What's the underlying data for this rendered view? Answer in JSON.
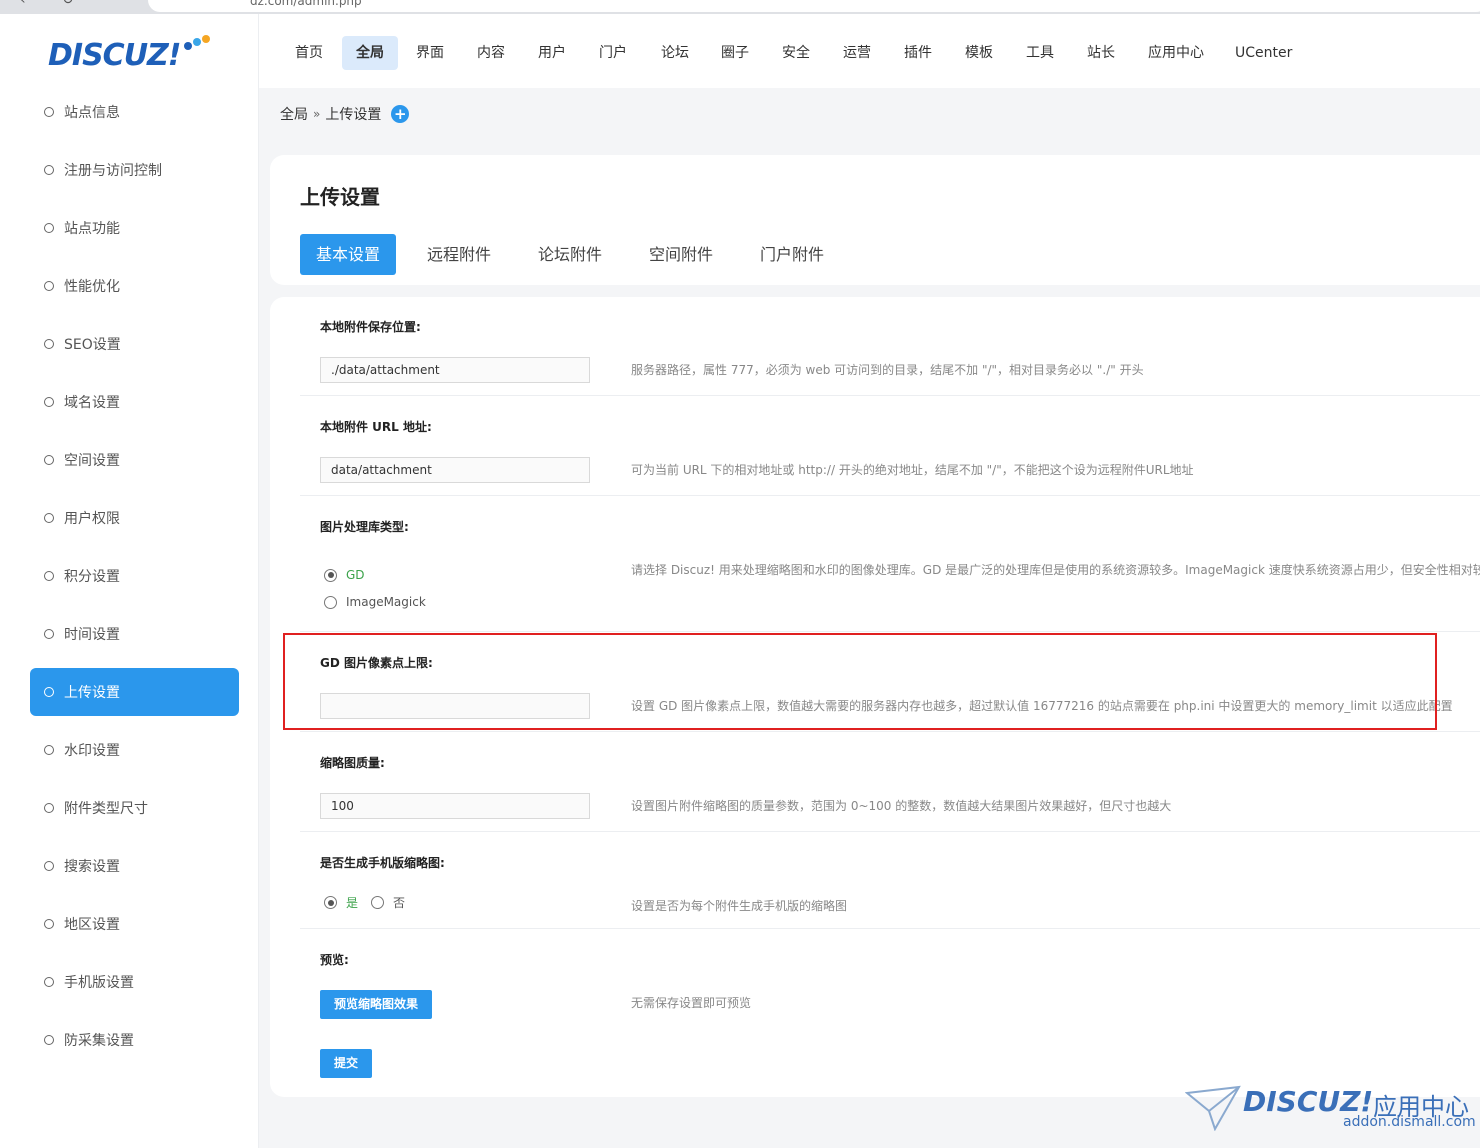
{
  "browser": {
    "url": "dz.com/admin.php"
  },
  "logo": {
    "text": "DISCUZ!"
  },
  "sidebar": {
    "items": [
      {
        "label": "站点信息"
      },
      {
        "label": "注册与访问控制"
      },
      {
        "label": "站点功能"
      },
      {
        "label": "性能优化"
      },
      {
        "label": "SEO设置"
      },
      {
        "label": "域名设置"
      },
      {
        "label": "空间设置"
      },
      {
        "label": "用户权限"
      },
      {
        "label": "积分设置"
      },
      {
        "label": "时间设置"
      },
      {
        "label": "上传设置",
        "active": true
      },
      {
        "label": "水印设置"
      },
      {
        "label": "附件类型尺寸"
      },
      {
        "label": "搜索设置"
      },
      {
        "label": "地区设置"
      },
      {
        "label": "手机版设置"
      },
      {
        "label": "防采集设置"
      }
    ]
  },
  "topnav": {
    "tabs": [
      {
        "label": "首页"
      },
      {
        "label": "全局",
        "active": true
      },
      {
        "label": "界面"
      },
      {
        "label": "内容"
      },
      {
        "label": "用户"
      },
      {
        "label": "门户"
      },
      {
        "label": "论坛"
      },
      {
        "label": "圈子"
      },
      {
        "label": "安全"
      },
      {
        "label": "运营"
      },
      {
        "label": "插件"
      },
      {
        "label": "模板"
      },
      {
        "label": "工具"
      },
      {
        "label": "站长"
      },
      {
        "label": "应用中心"
      },
      {
        "label": "UCenter"
      }
    ]
  },
  "breadcrumb": {
    "root": "全局",
    "sep": "»",
    "current": "上传设置",
    "plus": "+"
  },
  "header": {
    "title": "上传设置"
  },
  "subtabs": [
    {
      "label": "基本设置",
      "active": true
    },
    {
      "label": "远程附件"
    },
    {
      "label": "论坛附件"
    },
    {
      "label": "空间附件"
    },
    {
      "label": "门户附件"
    }
  ],
  "form": {
    "attach_dir": {
      "label": "本地附件保存位置:",
      "value": "./data/attachment",
      "hint": "服务器路径，属性 777，必须为 web 可访问到的目录，结尾不加 \"/\"，相对目录务必以 \"./\" 开头"
    },
    "attach_url": {
      "label": "本地附件 URL 地址:",
      "value": "data/attachment",
      "hint": "可为当前 URL 下的相对地址或 http:// 开头的绝对地址，结尾不加 \"/\"，不能把这个设为远程附件URL地址"
    },
    "image_lib": {
      "label": "图片处理库类型:",
      "options": [
        {
          "label": "GD",
          "checked": true
        },
        {
          "label": "ImageMagick",
          "checked": false
        }
      ],
      "hint": "请选择 Discuz! 用来处理缩略图和水印的图像处理库。GD 是最广泛的处理库但是使用的系统资源较多。ImageMagick 速度快系统资源占用少，但安全性相对较"
    },
    "gd_limit": {
      "label": "GD 图片像素点上限:",
      "value": "",
      "hint": "设置 GD 图片像素点上限，数值越大需要的服务器内存也越多，超过默认值 16777216 的站点需要在 php.ini 中设置更大的 memory_limit 以适应此配置"
    },
    "thumb_quality": {
      "label": "缩略图质量:",
      "value": "100",
      "hint": "设置图片附件缩略图的质量参数，范围为 0~100 的整数，数值越大结果图片效果越好，但尺寸也越大"
    },
    "mobile_thumb": {
      "label": "是否生成手机版缩略图:",
      "options": [
        {
          "label": "是",
          "checked": true
        },
        {
          "label": "否",
          "checked": false
        }
      ],
      "hint": "设置是否为每个附件生成手机版的缩略图"
    },
    "preview": {
      "label": "预览:",
      "button": "预览缩略图效果",
      "hint": "无需保存设置即可预览"
    },
    "submit": {
      "label": "提交"
    }
  },
  "watermark": {
    "brand": "DISCUZ!",
    "cn": "应用中心",
    "url": "addon.dismall.com"
  },
  "colors": {
    "accent": "#2b97ec",
    "highlight": "#e02020",
    "checked_text": "#3ba24a"
  }
}
